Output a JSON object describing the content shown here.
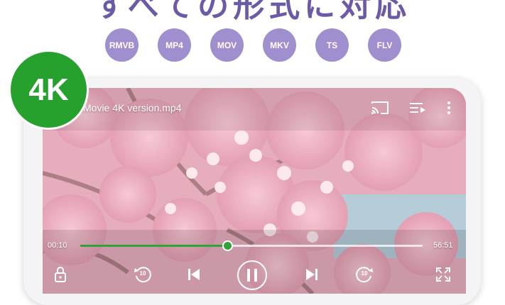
{
  "headline": "すべての形式に対応",
  "formats": [
    "RMVB",
    "MP4",
    "MOV",
    "MKV",
    "TS",
    "FLV"
  ],
  "badge": "4K",
  "player": {
    "title": "Movie 4K version.mp4",
    "elapsed": "00:10",
    "duration": "56:51",
    "progress": 0.43,
    "rewind_seconds": "10",
    "forward_seconds": "10"
  },
  "colors": {
    "headline": "#6d5aa6",
    "format_circle": "#a08fce",
    "badge": "#27a12d",
    "progress": "#2fa23a"
  },
  "icons": [
    "cast-icon",
    "playlist-icon",
    "more-icon",
    "lock-icon",
    "rewind-icon",
    "previous-icon",
    "pause-icon",
    "next-icon",
    "forward-icon",
    "fullscreen-icon"
  ]
}
